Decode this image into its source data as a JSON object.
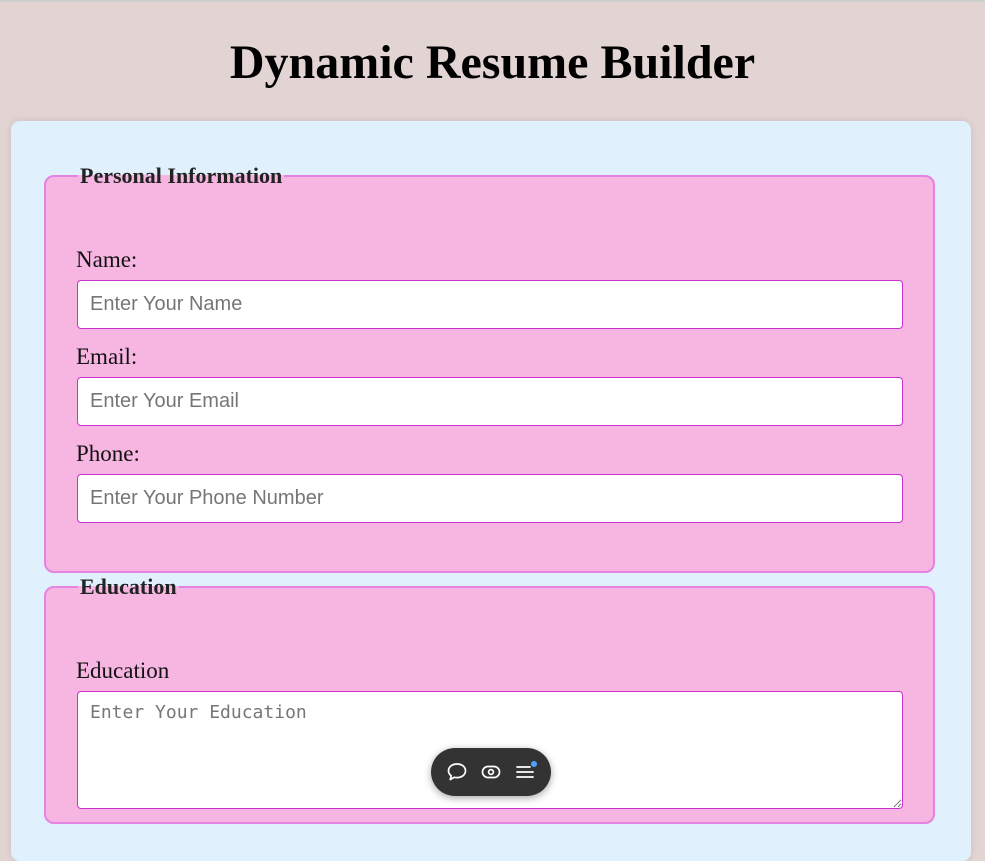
{
  "page": {
    "title": "Dynamic Resume Builder"
  },
  "personal": {
    "legend": "Personal Information",
    "name": {
      "label": "Name:",
      "placeholder": "Enter Your Name",
      "value": ""
    },
    "email": {
      "label": "Email:",
      "placeholder": "Enter Your Email",
      "value": ""
    },
    "phone": {
      "label": "Phone:",
      "placeholder": "Enter Your Phone Number",
      "value": ""
    }
  },
  "education": {
    "legend": "Education",
    "label": "Education",
    "placeholder": "Enter Your Education",
    "value": ""
  },
  "toolbar": {
    "icons": [
      "chat-bubble-icon",
      "eye-icon",
      "menu-list-icon"
    ],
    "notification_color": "#4ea2ff"
  },
  "colors": {
    "page_bg": "#e2d4d3",
    "container_bg": "#e1f0fd",
    "fieldset_bg": "#f7b5e1",
    "fieldset_border": "#e583e3",
    "input_border": "#cc33cc"
  }
}
